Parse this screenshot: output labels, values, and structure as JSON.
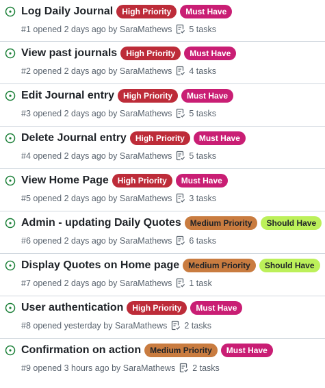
{
  "colors": {
    "high_priority": "#bd2c39",
    "must_have": "#c91e74",
    "medium_priority": "#c97c40",
    "should_have": "#bcf05a",
    "open_icon": "#1a7f37"
  },
  "issues": [
    {
      "title": "Log Daily Journal",
      "number": "#1",
      "opened": "opened 2 days ago by",
      "author": "SaraMathews",
      "tasks": "5 tasks",
      "labels": [
        {
          "text": "High Priority",
          "color": "#bd2c39",
          "fg": "#ffffff"
        },
        {
          "text": "Must Have",
          "color": "#c91e74",
          "fg": "#ffffff"
        }
      ]
    },
    {
      "title": "View past journals",
      "number": "#2",
      "opened": "opened 2 days ago by",
      "author": "SaraMathews",
      "tasks": "4 tasks",
      "labels": [
        {
          "text": "High Priority",
          "color": "#bd2c39",
          "fg": "#ffffff"
        },
        {
          "text": "Must Have",
          "color": "#c91e74",
          "fg": "#ffffff"
        }
      ]
    },
    {
      "title": "Edit Journal entry",
      "number": "#3",
      "opened": "opened 2 days ago by",
      "author": "SaraMathews",
      "tasks": "5 tasks",
      "labels": [
        {
          "text": "High Priority",
          "color": "#bd2c39",
          "fg": "#ffffff"
        },
        {
          "text": "Must Have",
          "color": "#c91e74",
          "fg": "#ffffff"
        }
      ]
    },
    {
      "title": "Delete Journal entry",
      "number": "#4",
      "opened": "opened 2 days ago by",
      "author": "SaraMathews",
      "tasks": "5 tasks",
      "labels": [
        {
          "text": "High Priority",
          "color": "#bd2c39",
          "fg": "#ffffff"
        },
        {
          "text": "Must Have",
          "color": "#c91e74",
          "fg": "#ffffff"
        }
      ]
    },
    {
      "title": "View Home Page",
      "number": "#5",
      "opened": "opened 2 days ago by",
      "author": "SaraMathews",
      "tasks": "3 tasks",
      "labels": [
        {
          "text": "High Priority",
          "color": "#bd2c39",
          "fg": "#ffffff"
        },
        {
          "text": "Must Have",
          "color": "#c91e74",
          "fg": "#ffffff"
        }
      ]
    },
    {
      "title": "Admin - updating Daily Quotes",
      "number": "#6",
      "opened": "opened 2 days ago by",
      "author": "SaraMathews",
      "tasks": "6 tasks",
      "labels": [
        {
          "text": "Medium Priority",
          "color": "#c97c40",
          "fg": "#1f2328"
        },
        {
          "text": "Should Have",
          "color": "#bcf05a",
          "fg": "#1f2328"
        }
      ]
    },
    {
      "title": "Display Quotes on Home page",
      "number": "#7",
      "opened": "opened 2 days ago by",
      "author": "SaraMathews",
      "tasks": "1 task",
      "labels": [
        {
          "text": "Medium Priority",
          "color": "#c97c40",
          "fg": "#1f2328"
        },
        {
          "text": "Should Have",
          "color": "#bcf05a",
          "fg": "#1f2328"
        }
      ]
    },
    {
      "title": "User authentication",
      "number": "#8",
      "opened": "opened yesterday by",
      "author": "SaraMathews",
      "tasks": "2 tasks",
      "labels": [
        {
          "text": "High Priority",
          "color": "#bd2c39",
          "fg": "#ffffff"
        },
        {
          "text": "Must Have",
          "color": "#c91e74",
          "fg": "#ffffff"
        }
      ]
    },
    {
      "title": "Confirmation on action",
      "number": "#9",
      "opened": "opened 3 hours ago by",
      "author": "SaraMathews",
      "tasks": "2 tasks",
      "labels": [
        {
          "text": "Medium Priority",
          "color": "#c97c40",
          "fg": "#1f2328"
        },
        {
          "text": "Must Have",
          "color": "#c91e74",
          "fg": "#ffffff"
        }
      ]
    }
  ]
}
